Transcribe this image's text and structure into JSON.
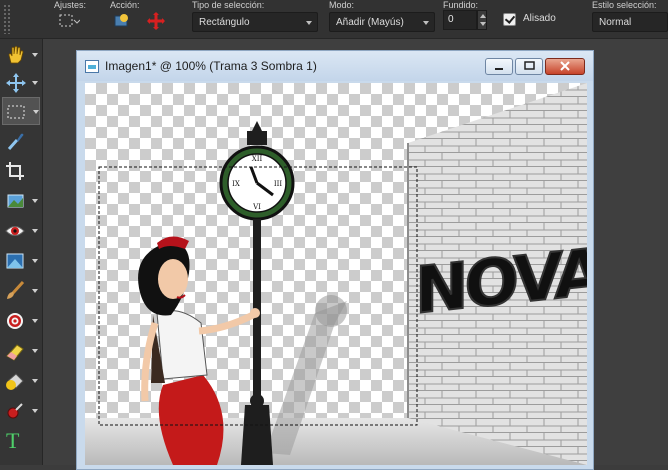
{
  "options_bar": {
    "presets_label": "Ajustes:",
    "action_label": "Acción:",
    "selection_type_label": "Tipo de selección:",
    "selection_type_value": "Rectángulo",
    "mode_label": "Modo:",
    "mode_value": "Añadir (Mayús)",
    "feather_label": "Fundido:",
    "feather_value": "0",
    "antialias_label": "Alisado",
    "antialias_checked": true,
    "selection_style_label": "Estilo selección:",
    "selection_style_value": "Normal"
  },
  "tools": [
    {
      "name": "pan-tool",
      "icon": "hand-icon"
    },
    {
      "name": "move-tool",
      "icon": "move-arrows-icon"
    },
    {
      "name": "selection-tool",
      "icon": "marquee-icon",
      "active": true
    },
    {
      "name": "dropper-tool",
      "icon": "dropper-icon"
    },
    {
      "name": "crop-tool",
      "icon": "crop-icon"
    },
    {
      "name": "straighten-tool",
      "icon": "straighten-icon"
    },
    {
      "name": "red-eye-tool",
      "icon": "eye-icon"
    },
    {
      "name": "makeover-tool",
      "icon": "makeover-icon"
    },
    {
      "name": "paint-brush-tool",
      "icon": "brush-icon"
    },
    {
      "name": "clone-brush-tool",
      "icon": "clone-icon"
    },
    {
      "name": "eraser-tool",
      "icon": "eraser-icon"
    },
    {
      "name": "fill-tool",
      "icon": "bucket-icon"
    },
    {
      "name": "picture-tube-tool",
      "icon": "pin-icon"
    },
    {
      "name": "text-tool",
      "icon": "text-icon",
      "glyph": "T"
    }
  ],
  "document": {
    "title": "Imagen1* @ 100% (Trama 3 Sombra 1)",
    "zoom": "100%",
    "graffiti_text": "NOVA"
  },
  "colors": {
    "skirt_red": "#c41a1a",
    "lamp_black": "#1e1e1e",
    "clock_green": "#2e5e2a"
  }
}
